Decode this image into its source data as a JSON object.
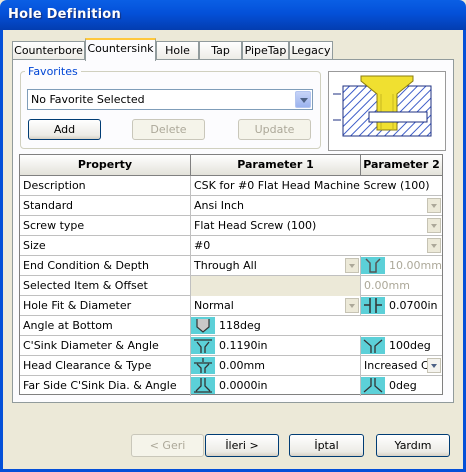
{
  "window": {
    "title": "Hole Definition"
  },
  "tabs": [
    {
      "label": "Counterbore",
      "active": false
    },
    {
      "label": "Countersink",
      "active": true
    },
    {
      "label": "Hole",
      "active": false
    },
    {
      "label": "Tap",
      "active": false
    },
    {
      "label": "PipeTap",
      "active": false
    },
    {
      "label": "Legacy",
      "active": false
    }
  ],
  "favorites": {
    "legend": "Favorites",
    "selected": "No Favorite Selected",
    "add_label": "Add",
    "delete_label": "Delete",
    "update_label": "Update"
  },
  "grid": {
    "headers": [
      "Property",
      "Parameter 1",
      "Parameter 2"
    ],
    "rows": [
      {
        "property": "Description",
        "param1": "CSK for #0 Flat Head Machine Screw (100)",
        "param2": ""
      },
      {
        "property": "Standard",
        "param1": "Ansi Inch",
        "param2": ""
      },
      {
        "property": "Screw type",
        "param1": "Flat Head Screw (100)",
        "param2": ""
      },
      {
        "property": "Size",
        "param1": "#0",
        "param2": ""
      },
      {
        "property": "End Condition & Depth",
        "param1": "Through All",
        "param2": "10.00mm"
      },
      {
        "property": "Selected Item & Offset",
        "param1": "",
        "param2": "0.00mm"
      },
      {
        "property": "Hole Fit & Diameter",
        "param1": "Normal",
        "param2": "0.0700in"
      },
      {
        "property": "Angle at Bottom",
        "param1": "118deg",
        "param2": ""
      },
      {
        "property": "C'Sink Diameter & Angle",
        "param1": "0.1190in",
        "param2": "100deg"
      },
      {
        "property": "Head Clearance & Type",
        "param1": "0.00mm",
        "param2": "Increased C'"
      },
      {
        "property": "Far Side C'Sink Dia. & Angle",
        "param1": "0.0000in",
        "param2": "0deg"
      }
    ]
  },
  "buttons": {
    "back": "< Geri",
    "next": "İleri >",
    "cancel": "İptal",
    "help": "Yardım"
  },
  "colors": {
    "title_bar": "#0450d8",
    "icon_fill": "#5cd0d8",
    "preview_bolt": "#f0e030",
    "preview_hatch": "#3c5cc8"
  }
}
